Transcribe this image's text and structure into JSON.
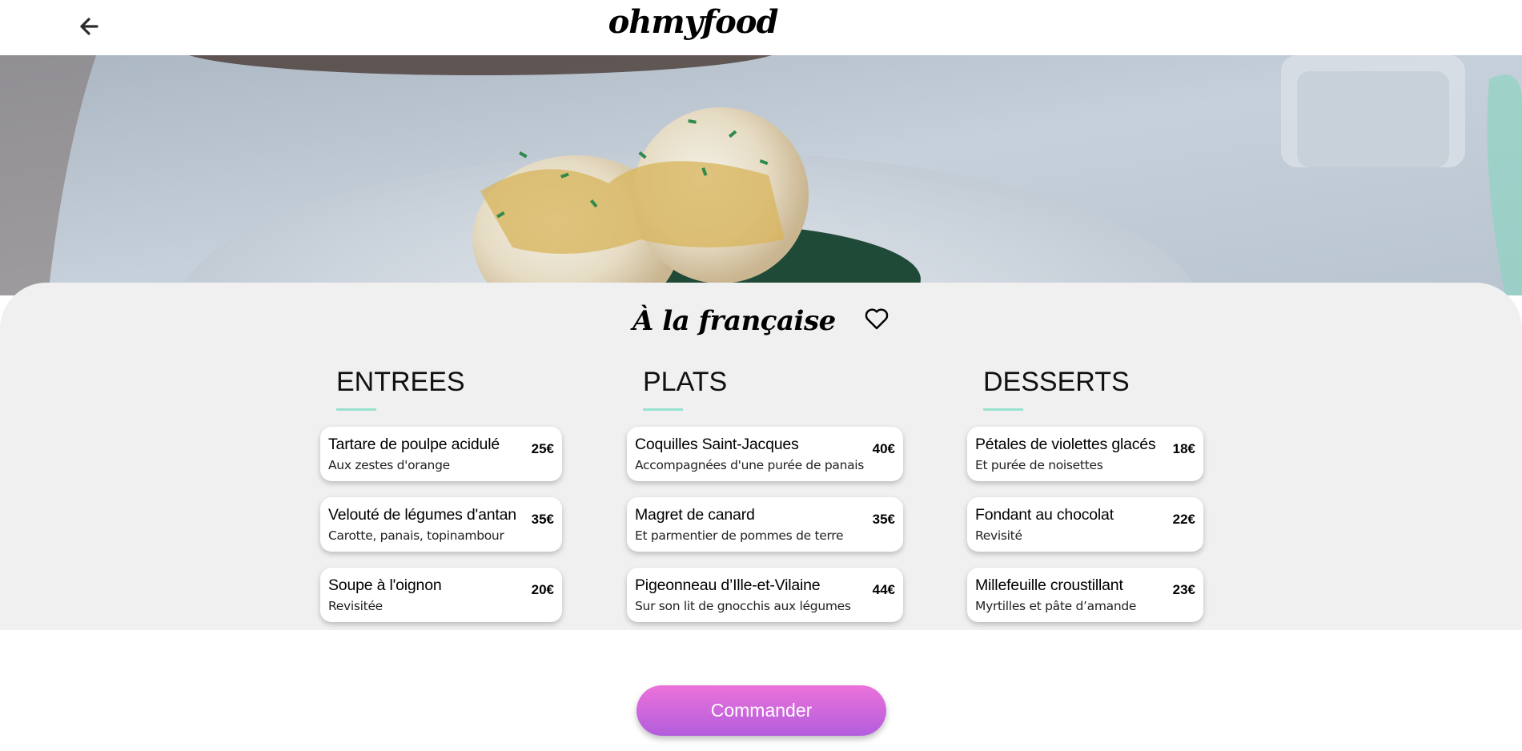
{
  "header": {
    "back_icon": "arrow-left-icon",
    "logo": "ohmyfood"
  },
  "hero": {
    "image": "poached-eggs-hollandaise-spinach-photo"
  },
  "restaurant": {
    "title": "À la française",
    "favorite_icon": "heart-outline-icon"
  },
  "menu": {
    "accent_color": "#99e2d0",
    "sections": [
      {
        "heading": "ENTREES",
        "items": [
          {
            "name": "Tartare de poulpe acidulé",
            "desc": "Aux zestes d'orange",
            "price": "25€"
          },
          {
            "name": "Velouté de légumes d'antan",
            "desc": "Carotte, panais, topinambour",
            "price": "35€"
          },
          {
            "name": "Soupe à l'oignon",
            "desc": "Revisitée",
            "price": "20€"
          }
        ]
      },
      {
        "heading": "PLATS",
        "items": [
          {
            "name": "Coquilles Saint-Jacques",
            "desc": "Accompagnées d'une purée de panais",
            "price": "40€"
          },
          {
            "name": "Magret de canard",
            "desc": "Et parmentier de pommes de terre",
            "price": "35€"
          },
          {
            "name": "Pigeonneau d’Ille-et-Vilaine",
            "desc": "Sur son lit de gnocchis aux légumes",
            "price": "44€"
          }
        ]
      },
      {
        "heading": "DESSERTS",
        "items": [
          {
            "name": "Pétales de violettes glacés",
            "desc": "Et purée de noisettes",
            "price": "18€"
          },
          {
            "name": "Fondant au chocolat",
            "desc": "Revisité",
            "price": "22€"
          },
          {
            "name": "Millefeuille croustillant",
            "desc": "Myrtilles et pâte d’amande",
            "price": "23€"
          }
        ]
      }
    ]
  },
  "order": {
    "label": "Commander",
    "gradient": [
      "#ec72da",
      "#b25ddd"
    ]
  }
}
